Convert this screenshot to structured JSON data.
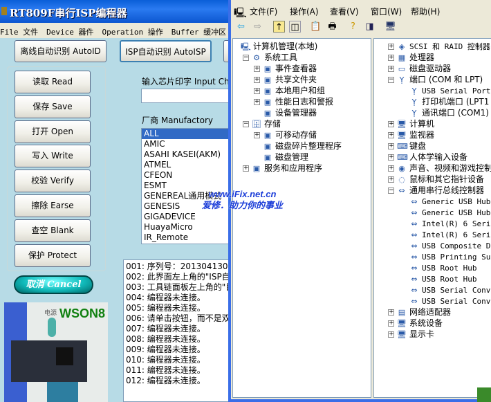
{
  "app": {
    "title": "RT809F串行ISP编程器",
    "menu": [
      "File 文件",
      "Device 器件",
      "Operation 操作",
      "Buffer 缓冲区"
    ],
    "top_buttons": [
      "离线自动识别 AutoID",
      "ISP自动识别 AutoISP"
    ],
    "side_buttons": [
      "读取 Read",
      "保存 Save",
      "打开 Open",
      "写入 Write",
      "校验 Verify",
      "擦除 Earse",
      "查空 Blank",
      "保护 Protect"
    ],
    "chip_label": "输入芯片印字 Input Chi",
    "chip_value": "",
    "mfg_label": "厂商 Manufactory",
    "manufacturers": [
      "ALL",
      "AMIC",
      "ASAHI KASEI(AKM)",
      "ATMEL",
      "CFEON",
      "ESMT",
      "GENEREAL通用模式",
      "GENESIS",
      "GIGADEVICE",
      "HuayaMicro",
      "IR_Remote"
    ],
    "selected_manufacturer": "ALL",
    "cancel_label": "取消 Cancel",
    "photo": {
      "package": "WSON8",
      "power_label": "电源"
    },
    "log": [
      "001: 序列号：2013041305",
      "002: 此界面左上角的\"ISP自",
      "003: 工具链面板左上角的\"目",
      "004: 编程器未连接。",
      "005: 编程器未连接。",
      "006: 请单击按钮，而不是双",
      "007: 编程器未连接。",
      "008: 编程器未连接。",
      "009: 编程器未连接。",
      "010: 编程器未连接。",
      "011: 编程器未连接。",
      "012: 编程器未连接。"
    ]
  },
  "watermark": {
    "line1": "www.iFix.net.cn",
    "line2": "爱修．助力你的事业"
  },
  "mmc": {
    "menu": [
      "文件(F)",
      "操作(A)",
      "查看(V)",
      "窗口(W)",
      "帮助(H)"
    ],
    "tree": [
      {
        "label": "计算机管理(本地)",
        "level": 0,
        "exp": "",
        "icon": "computer-management-icon"
      },
      {
        "label": "系统工具",
        "level": 1,
        "exp": "-",
        "icon": "tools-icon"
      },
      {
        "label": "事件查看器",
        "level": 2,
        "exp": "+",
        "icon": "event-viewer-icon"
      },
      {
        "label": "共享文件夹",
        "level": 2,
        "exp": "+",
        "icon": "shared-folder-icon"
      },
      {
        "label": "本地用户和组",
        "level": 2,
        "exp": "+",
        "icon": "users-icon"
      },
      {
        "label": "性能日志和警报",
        "level": 2,
        "exp": "+",
        "icon": "performance-icon"
      },
      {
        "label": "设备管理器",
        "level": 2,
        "exp": "",
        "icon": "device-manager-icon"
      },
      {
        "label": "存储",
        "level": 1,
        "exp": "-",
        "icon": "storage-icon"
      },
      {
        "label": "可移动存储",
        "level": 2,
        "exp": "+",
        "icon": "removable-storage-icon"
      },
      {
        "label": "磁盘碎片整理程序",
        "level": 2,
        "exp": "",
        "icon": "defrag-icon"
      },
      {
        "label": "磁盘管理",
        "level": 2,
        "exp": "",
        "icon": "disk-management-icon"
      },
      {
        "label": "服务和应用程序",
        "level": 1,
        "exp": "+",
        "icon": "services-icon"
      }
    ],
    "devices": [
      {
        "label": "SCSI 和 RAID 控制器",
        "level": 0,
        "exp": "+",
        "icon": "scsi-icon"
      },
      {
        "label": "处理器",
        "level": 0,
        "exp": "+",
        "icon": "processor-icon"
      },
      {
        "label": "磁盘驱动器",
        "level": 0,
        "exp": "+",
        "icon": "disk-drive-icon"
      },
      {
        "label": "端口 (COM 和 LPT)",
        "level": 0,
        "exp": "-",
        "icon": "port-icon"
      },
      {
        "label": "USB Serial Port",
        "level": 1,
        "exp": "",
        "icon": "port-icon"
      },
      {
        "label": "打印机端口 (LPT1",
        "level": 1,
        "exp": "",
        "icon": "port-icon"
      },
      {
        "label": "通讯端口 (COM1)",
        "level": 1,
        "exp": "",
        "icon": "port-icon"
      },
      {
        "label": "计算机",
        "level": 0,
        "exp": "+",
        "icon": "computer-icon"
      },
      {
        "label": "监视器",
        "level": 0,
        "exp": "+",
        "icon": "monitor-icon"
      },
      {
        "label": "键盘",
        "level": 0,
        "exp": "+",
        "icon": "keyboard-icon"
      },
      {
        "label": "人体学输入设备",
        "level": 0,
        "exp": "+",
        "icon": "hid-icon"
      },
      {
        "label": "声音、视频和游戏控制",
        "level": 0,
        "exp": "+",
        "icon": "sound-icon"
      },
      {
        "label": "鼠标和其它指针设备",
        "level": 0,
        "exp": "+",
        "icon": "mouse-icon"
      },
      {
        "label": "通用串行总线控制器",
        "level": 0,
        "exp": "-",
        "icon": "usb-icon"
      },
      {
        "label": "Generic USB Hub",
        "level": 1,
        "exp": "",
        "icon": "usb-icon"
      },
      {
        "label": "Generic USB Hub",
        "level": 1,
        "exp": "",
        "icon": "usb-icon"
      },
      {
        "label": "Intel(R) 6 Serie",
        "level": 1,
        "exp": "",
        "icon": "usb-icon"
      },
      {
        "label": "Intel(R) 6 Serie",
        "level": 1,
        "exp": "",
        "icon": "usb-icon"
      },
      {
        "label": "USB Composite De",
        "level": 1,
        "exp": "",
        "icon": "usb-icon"
      },
      {
        "label": "USB Printing Sup",
        "level": 1,
        "exp": "",
        "icon": "usb-icon"
      },
      {
        "label": "USB Root Hub",
        "level": 1,
        "exp": "",
        "icon": "usb-icon"
      },
      {
        "label": "USB Root Hub",
        "level": 1,
        "exp": "",
        "icon": "usb-icon"
      },
      {
        "label": "USB Serial Conve",
        "level": 1,
        "exp": "",
        "icon": "usb-icon"
      },
      {
        "label": "USB Serial Conve",
        "level": 1,
        "exp": "",
        "icon": "usb-icon"
      },
      {
        "label": "网络适配器",
        "level": 0,
        "exp": "+",
        "icon": "network-icon"
      },
      {
        "label": "系统设备",
        "level": 0,
        "exp": "+",
        "icon": "system-device-icon"
      },
      {
        "label": "显示卡",
        "level": 0,
        "exp": "+",
        "icon": "display-adapter-icon"
      }
    ]
  }
}
